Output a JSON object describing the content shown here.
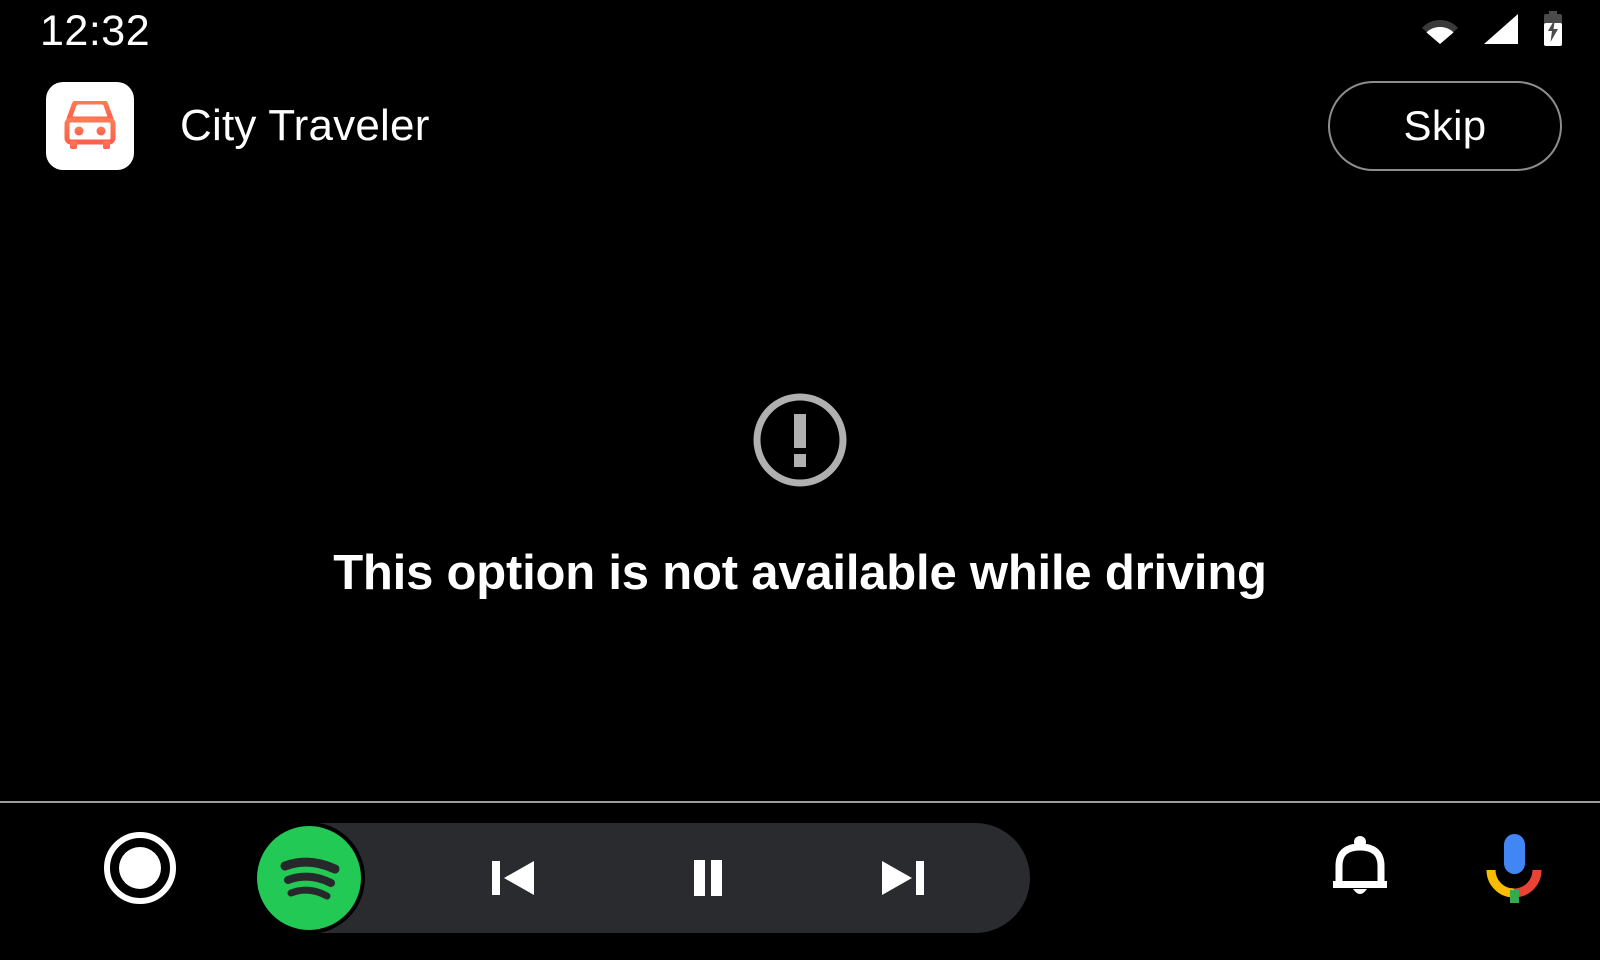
{
  "status_bar": {
    "clock": "12:32",
    "icons": [
      {
        "name": "wifi-icon",
        "label": "Wi-Fi"
      },
      {
        "name": "cell-signal-icon",
        "label": "Cellular signal"
      },
      {
        "name": "battery-charging-icon",
        "label": "Battery charging"
      }
    ]
  },
  "header": {
    "app_icon_name": "car-front-icon",
    "app_title": "City Traveler",
    "skip_label": "Skip"
  },
  "main": {
    "warning_icon_name": "error-exclamation-circle-icon",
    "message": "This option is not available while driving"
  },
  "nav_bar": {
    "home_label": "Home",
    "media": {
      "app_name": "Spotify",
      "app_icon_name": "spotify-icon",
      "controls": [
        {
          "name": "skip-previous-button",
          "label": "Previous track"
        },
        {
          "name": "pause-button",
          "label": "Pause"
        },
        {
          "name": "skip-next-button",
          "label": "Next track"
        }
      ]
    },
    "notifications_label": "Notifications",
    "assistant_label": "Google Assistant"
  },
  "colors": {
    "background": "#000000",
    "app_icon_bg": "#ffffff",
    "car_icon": "#ff6b4f",
    "text_primary": "#ffffff",
    "warning_icon": "#b0b0b0",
    "divider": "#9a9a9a",
    "media_pill_bg": "#2a2b2e",
    "spotify_green": "#22c954",
    "skip_border": "#8d8d8d",
    "assistant_blue": "#4285f4",
    "assistant_red": "#ea4335",
    "assistant_yellow": "#fbbc04",
    "assistant_green": "#34a853"
  }
}
